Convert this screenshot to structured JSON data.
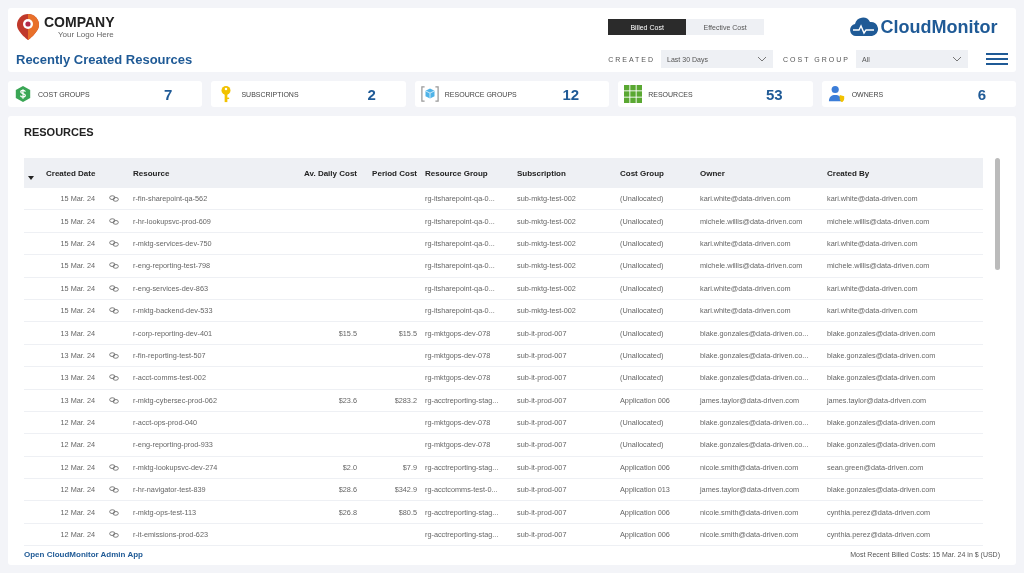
{
  "header": {
    "company_logo": {
      "name": "COMPANY",
      "tagline": "Your Logo Here"
    },
    "title": "Recently Created Resources",
    "cost_toggle": [
      {
        "label": "Billed Cost",
        "selected": true
      },
      {
        "label": "Effective Cost",
        "selected": false
      }
    ],
    "brand": "CloudMonitor",
    "filters": [
      {
        "label": "CREATED",
        "value": "Last 30 Days"
      },
      {
        "label": "COST GROUP",
        "value": "All"
      }
    ]
  },
  "kpis": [
    {
      "kind": "cost-groups",
      "label": "COST GROUPS",
      "value": "7"
    },
    {
      "kind": "subscriptions",
      "label": "SUBSCRIPTIONS",
      "value": "2"
    },
    {
      "kind": "resource-groups",
      "label": "RESOURCE GROUPS",
      "value": "12"
    },
    {
      "kind": "resources",
      "label": "RESOURCES",
      "value": "53"
    },
    {
      "kind": "owners",
      "label": "OWNERS",
      "value": "6"
    }
  ],
  "resources": {
    "title": "RESOURCES",
    "columns": [
      "Created Date",
      "Resource",
      "Av. Daily Cost",
      "Period Cost",
      "Resource Group",
      "Subscription",
      "Cost Group",
      "Owner",
      "Created By"
    ],
    "rows": [
      {
        "created": "15 Mar. 24",
        "linked": true,
        "resource": "r-fin-sharepoint-qa-562",
        "resource_group": "rg-itsharepoint-qa-0...",
        "subscription": "sub-mktg-test-002",
        "cost_group": "(Unallocated)",
        "owner": "kari.white@data-driven.com",
        "created_by": "kari.white@data-driven.com"
      },
      {
        "created": "15 Mar. 24",
        "linked": true,
        "resource": "r-hr-lookupsvc-prod-609",
        "resource_group": "rg-itsharepoint-qa-0...",
        "subscription": "sub-mktg-test-002",
        "cost_group": "(Unallocated)",
        "owner": "michele.willis@data-driven.com",
        "created_by": "michele.willis@data-driven.com"
      },
      {
        "created": "15 Mar. 24",
        "linked": true,
        "resource": "r-mktg-services-dev-750",
        "resource_group": "rg-itsharepoint-qa-0...",
        "subscription": "sub-mktg-test-002",
        "cost_group": "(Unallocated)",
        "owner": "kari.white@data-driven.com",
        "created_by": "kari.white@data-driven.com"
      },
      {
        "created": "15 Mar. 24",
        "linked": true,
        "resource": "r-eng-reporting-test-798",
        "resource_group": "rg-itsharepoint-qa-0...",
        "subscription": "sub-mktg-test-002",
        "cost_group": "(Unallocated)",
        "owner": "michele.willis@data-driven.com",
        "created_by": "michele.willis@data-driven.com"
      },
      {
        "created": "15 Mar. 24",
        "linked": true,
        "resource": "r-eng-services-dev-863",
        "resource_group": "rg-itsharepoint-qa-0...",
        "subscription": "sub-mktg-test-002",
        "cost_group": "(Unallocated)",
        "owner": "kari.white@data-driven.com",
        "created_by": "kari.white@data-driven.com"
      },
      {
        "created": "15 Mar. 24",
        "linked": true,
        "resource": "r-mktg-backend-dev-533",
        "resource_group": "rg-itsharepoint-qa-0...",
        "subscription": "sub-mktg-test-002",
        "cost_group": "(Unallocated)",
        "owner": "kari.white@data-driven.com",
        "created_by": "kari.white@data-driven.com"
      },
      {
        "created": "13 Mar. 24",
        "linked": false,
        "resource": "r-corp-reporting-dev-401",
        "avg_daily": "$15.5",
        "period_cost": "$15.5",
        "resource_group": "rg-mktgops-dev-078",
        "subscription": "sub-it-prod-007",
        "cost_group": "(Unallocated)",
        "owner": "blake.gonzales@data-driven.co...",
        "created_by": "blake.gonzales@data-driven.com"
      },
      {
        "created": "13 Mar. 24",
        "linked": true,
        "resource": "r-fin-reporting-test-507",
        "resource_group": "rg-mktgops-dev-078",
        "subscription": "sub-it-prod-007",
        "cost_group": "(Unallocated)",
        "owner": "blake.gonzales@data-driven.co...",
        "created_by": "blake.gonzales@data-driven.com"
      },
      {
        "created": "13 Mar. 24",
        "linked": true,
        "resource": "r-acct-comms-test-002",
        "resource_group": "rg-mktgops-dev-078",
        "subscription": "sub-it-prod-007",
        "cost_group": "(Unallocated)",
        "owner": "blake.gonzales@data-driven.co...",
        "created_by": "blake.gonzales@data-driven.com"
      },
      {
        "created": "13 Mar. 24",
        "linked": true,
        "resource": "r-mktg-cybersec-prod-062",
        "avg_daily": "$23.6",
        "period_cost": "$283.2",
        "resource_group": "rg-acctreporting-stag...",
        "subscription": "sub-it-prod-007",
        "cost_group": "Application 006",
        "owner": "james.taylor@data-driven.com",
        "created_by": "james.taylor@data-driven.com"
      },
      {
        "created": "12 Mar. 24",
        "linked": false,
        "resource": "r-acct-ops-prod-040",
        "resource_group": "rg-mktgops-dev-078",
        "subscription": "sub-it-prod-007",
        "cost_group": "(Unallocated)",
        "owner": "blake.gonzales@data-driven.co...",
        "created_by": "blake.gonzales@data-driven.com"
      },
      {
        "created": "12 Mar. 24",
        "linked": false,
        "resource": "r-eng-reporting-prod-933",
        "resource_group": "rg-mktgops-dev-078",
        "subscription": "sub-it-prod-007",
        "cost_group": "(Unallocated)",
        "owner": "blake.gonzales@data-driven.co...",
        "created_by": "blake.gonzales@data-driven.com"
      },
      {
        "created": "12 Mar. 24",
        "linked": true,
        "resource": "r-mktg-lookupsvc-dev-274",
        "avg_daily": "$2.0",
        "period_cost": "$7.9",
        "resource_group": "rg-acctreporting-stag...",
        "subscription": "sub-it-prod-007",
        "cost_group": "Application 006",
        "owner": "nicole.smith@data-driven.com",
        "created_by": "sean.green@data-driven.com"
      },
      {
        "created": "12 Mar. 24",
        "linked": true,
        "resource": "r-hr-navigator-test-839",
        "avg_daily": "$28.6",
        "period_cost": "$342.9",
        "resource_group": "rg-acctcomms-test-0...",
        "subscription": "sub-it-prod-007",
        "cost_group": "Application 013",
        "owner": "james.taylor@data-driven.com",
        "created_by": "blake.gonzales@data-driven.com"
      },
      {
        "created": "12 Mar. 24",
        "linked": true,
        "resource": "r-mktg-ops-test-113",
        "avg_daily": "$26.8",
        "period_cost": "$80.5",
        "resource_group": "rg-acctreporting-stag...",
        "subscription": "sub-it-prod-007",
        "cost_group": "Application 006",
        "owner": "nicole.smith@data-driven.com",
        "created_by": "cynthia.perez@data-driven.com"
      },
      {
        "created": "12 Mar. 24",
        "linked": true,
        "resource": "r-it-emissions-prod-623",
        "resource_group": "rg-acctreporting-stag...",
        "subscription": "sub-it-prod-007",
        "cost_group": "Application 006",
        "owner": "nicole.smith@data-driven.com",
        "created_by": "cynthia.perez@data-driven.com"
      }
    ]
  },
  "footer": {
    "admin_link": "Open CloudMonitor Admin App",
    "note": "Most Recent Billed Costs: 15 Mar. 24 in $ (USD)"
  }
}
